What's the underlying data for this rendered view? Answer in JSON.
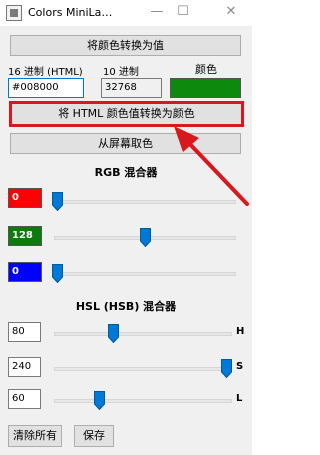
{
  "window": {
    "title": "Colors MiniLa…",
    "minimize": "—",
    "maximize": "☐",
    "close": "✕"
  },
  "buttons": {
    "color_to_value": "将颜色转换为值",
    "html_to_color": "将 HTML 颜色值转换为颜色",
    "pick_screen": "从屏幕取色",
    "clear_all": "清除所有",
    "save": "保存"
  },
  "values": {
    "hex_label": "16 进制 (HTML)",
    "hex_value": "#008000",
    "dec_label": "10 进制",
    "dec_value": "32768",
    "color_label": "颜色",
    "color": "#0d8a0d"
  },
  "rgb": {
    "header": "RGB 混合器",
    "red": {
      "value": "0",
      "color": "#ff0000",
      "fraction": 0.0
    },
    "green": {
      "value": "128",
      "color": "#0d7a0d",
      "fraction": 0.5
    },
    "blue": {
      "value": "0",
      "color": "#0000ff",
      "fraction": 0.0
    }
  },
  "hsl": {
    "header": "HSL (HSB) 混合器",
    "h": {
      "value": "80",
      "label": "H",
      "fraction": 0.33
    },
    "s": {
      "value": "240",
      "label": "S",
      "fraction": 1.0
    },
    "l": {
      "value": "60",
      "label": "L",
      "fraction": 0.25
    }
  },
  "accent_color": "#d8181c"
}
